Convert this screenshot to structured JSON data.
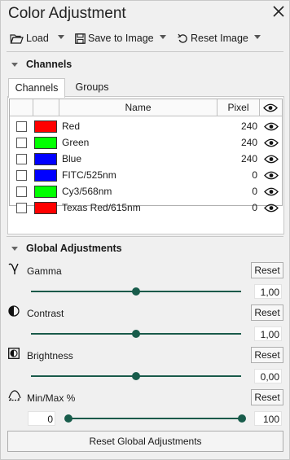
{
  "window": {
    "title": "Color Adjustment"
  },
  "toolbar": {
    "load_label": "Load",
    "save_label": "Save to Image",
    "reset_label": "Reset Image"
  },
  "channels": {
    "section_title": "Channels",
    "tabs": [
      {
        "label": "Channels"
      },
      {
        "label": "Groups"
      }
    ],
    "columns": {
      "name": "Name",
      "pixel": "Pixel"
    },
    "rows": [
      {
        "name": "Red",
        "pixel": "240",
        "color": "#ff0000",
        "checked": false
      },
      {
        "name": "Green",
        "pixel": "240",
        "color": "#00ff00",
        "checked": false
      },
      {
        "name": "Blue",
        "pixel": "240",
        "color": "#0000ff",
        "checked": false
      },
      {
        "name": "FITC/525nm",
        "pixel": "0",
        "color": "#0000ff",
        "checked": false
      },
      {
        "name": "Cy3/568nm",
        "pixel": "0",
        "color": "#00ff00",
        "checked": false
      },
      {
        "name": "Texas Red/615nm",
        "pixel": "0",
        "color": "#ff0000",
        "checked": false
      }
    ]
  },
  "global": {
    "section_title": "Global Adjustments",
    "reset_label": "Reset",
    "gamma": {
      "label": "Gamma",
      "value": "1,00",
      "position": 0.5
    },
    "contrast": {
      "label": "Contrast",
      "value": "1,00",
      "position": 0.5
    },
    "brightness": {
      "label": "Brightness",
      "value": "0,00",
      "position": 0.5
    },
    "minmax": {
      "label": "Min/Max %",
      "min_value": "0",
      "max_value": "100",
      "min_position": 0.0,
      "max_position": 1.0
    },
    "reset_all_label": "Reset Global Adjustments"
  },
  "colors": {
    "accent": "#185c4b",
    "border": "#c8c8c8"
  }
}
